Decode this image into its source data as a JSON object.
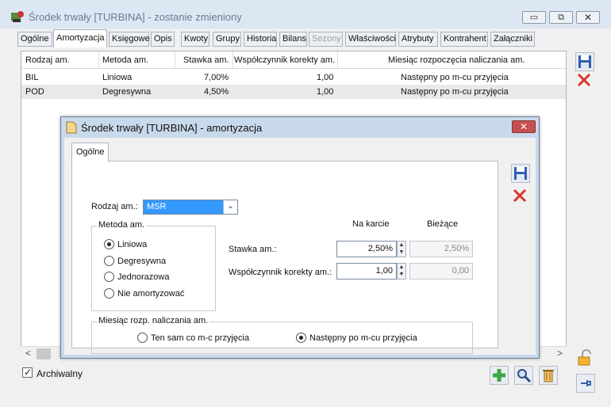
{
  "window": {
    "title": "Środek trwały [TURBINA] - zostanie zmieniony",
    "minimize_glyph": "▭",
    "maximize_glyph": "⧉",
    "close_glyph": "✕"
  },
  "tabs": [
    {
      "label": "Ogólne"
    },
    {
      "label": "Amortyzacja"
    },
    {
      "label": "Księgowe"
    },
    {
      "label": "Opis"
    },
    {
      "label": "Kwoty"
    },
    {
      "label": "Grupy"
    },
    {
      "label": "Historia"
    },
    {
      "label": "Bilans"
    },
    {
      "label": "Sezony"
    },
    {
      "label": "Właściwości"
    },
    {
      "label": "Atrybuty"
    },
    {
      "label": "Kontrahent"
    },
    {
      "label": "Załączniki"
    }
  ],
  "grid": {
    "columns": [
      "Rodzaj am.",
      "Metoda am.",
      "Stawka am.",
      "Współczynnik korekty am.",
      "Miesiąc rozpoczęcia naliczania am."
    ],
    "rows": [
      [
        "BIL",
        "Liniowa",
        "7,00%",
        "1,00",
        "Następny po m-cu przyjęcia"
      ],
      [
        "POD",
        "Degresywna",
        "4,50%",
        "1,00",
        "Następny po m-cu przyjęcia"
      ]
    ],
    "scroll_left": "<",
    "scroll_right": ">"
  },
  "footer": {
    "archiwalny_label": "Archiwalny",
    "archiwalny_checked": "✓"
  },
  "dialog": {
    "title": "Środek trwały [TURBINA] - amortyzacja",
    "close_glyph": "✕",
    "tab_label": "Ogólne",
    "rodzaj_label": "Rodzaj am.:",
    "rodzaj_value": "MSR",
    "dropdown_glyph": "⌄",
    "metoda_legend": "Metoda am.",
    "metoda_options": [
      "Liniowa",
      "Degresywna",
      "Jednorazowa",
      "Nie amortyzować"
    ],
    "metoda_selected": "Liniowa",
    "col_na_karcie": "Na karcie",
    "col_biezace": "Bieżące",
    "stawka_label": "Stawka am.:",
    "stawka_value": "2,50%",
    "stawka_current": "2,50%",
    "wspolczynnik_label": "Współczynnik korekty am.:",
    "wspolczynnik_value": "1,00",
    "wspolczynnik_current": "0,00",
    "miesiac_legend": "Miesiąc rozp. naliczania am.",
    "miesiac_options": [
      "Ten sam co m-c przyjęcia",
      "Następny po m-cu przyjęcia"
    ],
    "miesiac_selected": "Następny po m-cu przyjęcia",
    "spin_up": "▲",
    "spin_down": "▼"
  },
  "colors": {
    "accent": "#3399ff",
    "delete_red": "#d9342b",
    "add_green": "#3aa845",
    "save_blue": "#2f5fb3"
  }
}
